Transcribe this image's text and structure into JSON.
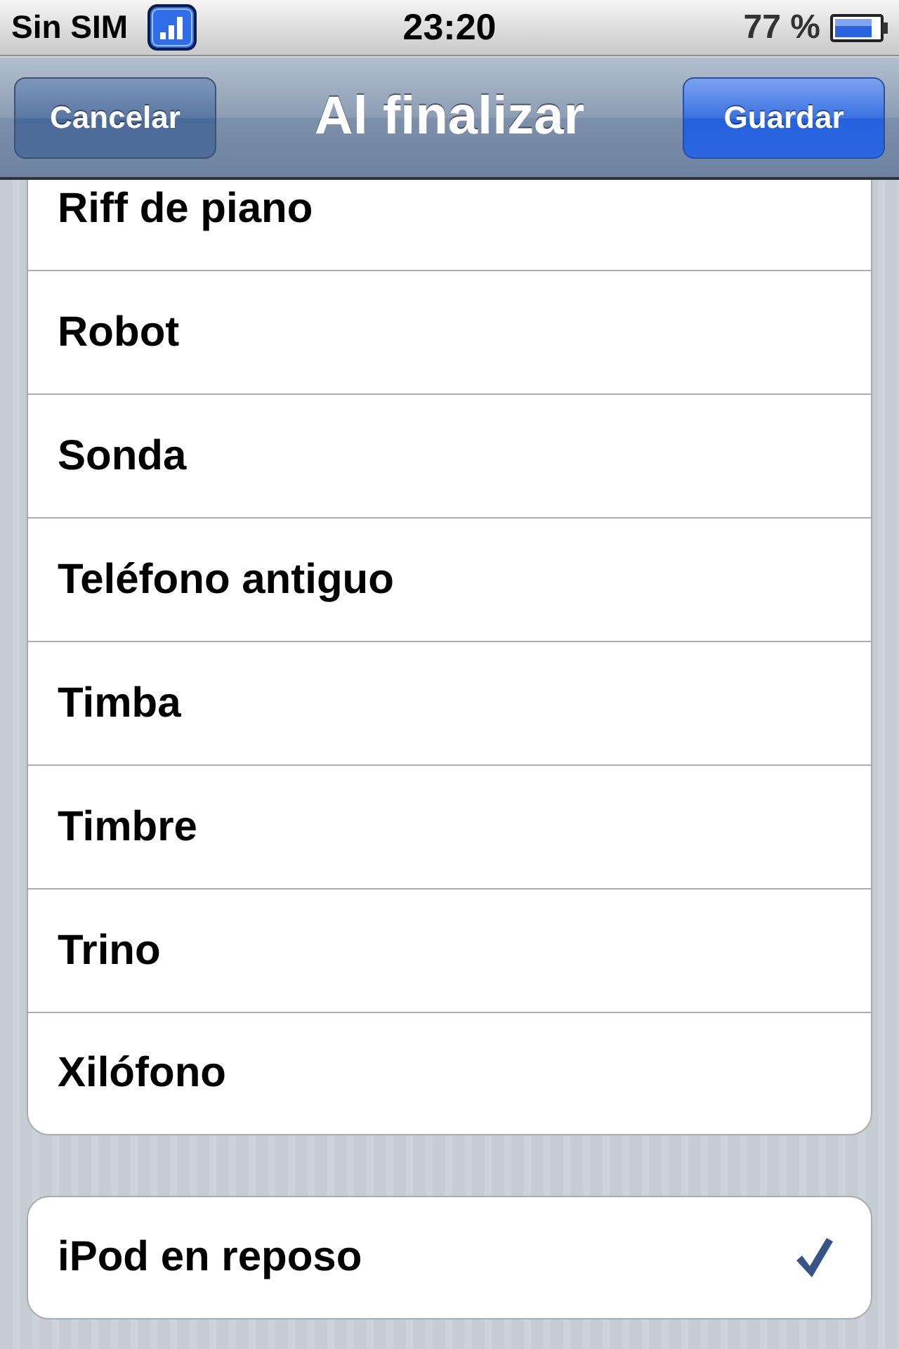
{
  "status_bar": {
    "carrier": "Sin SIM",
    "time": "23:20",
    "battery": "77 %"
  },
  "nav_bar": {
    "left_button": {
      "label": "Cancelar",
      "kind": "plain"
    },
    "title": "Al finalizar",
    "right_button": {
      "label": "Guardar",
      "kind": "done"
    }
  },
  "groups": [
    {
      "items": [
        {
          "label": "Riff de piano",
          "selected": false
        },
        {
          "label": "Robot",
          "selected": false
        },
        {
          "label": "Sonda",
          "selected": false
        },
        {
          "label": "Teléfono antiguo",
          "selected": false
        },
        {
          "label": "Timba",
          "selected": false
        },
        {
          "label": "Timbre",
          "selected": false
        },
        {
          "label": "Trino",
          "selected": false
        },
        {
          "label": "Xilófono",
          "selected": false
        }
      ]
    },
    {
      "items": [
        {
          "label": "iPod en reposo",
          "selected": true
        }
      ]
    }
  ]
}
